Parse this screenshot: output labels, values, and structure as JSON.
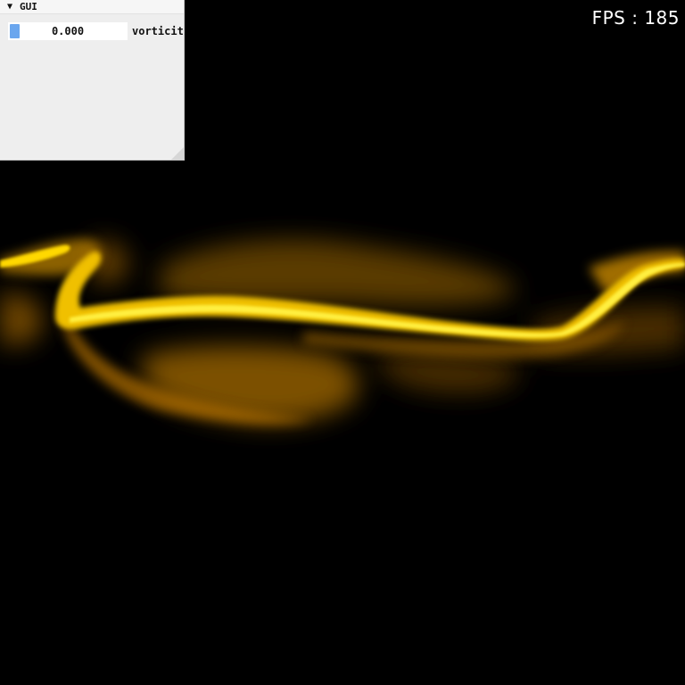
{
  "fps": {
    "text": "FPS : 185"
  },
  "gui": {
    "title": "GUI",
    "collapse_icon": "triangle-down-icon",
    "collapse_glyph": "▼",
    "slider": {
      "value_text": "0.000",
      "value": 0.0,
      "label": "vorticity"
    }
  },
  "colors": {
    "background": "#000000",
    "smoke_core": "#ffe000",
    "smoke_body": "#c07800",
    "smoke_dim": "#5a3800",
    "slider_grab": "#6aa6ee",
    "panel_bg": "#eeeeee"
  }
}
